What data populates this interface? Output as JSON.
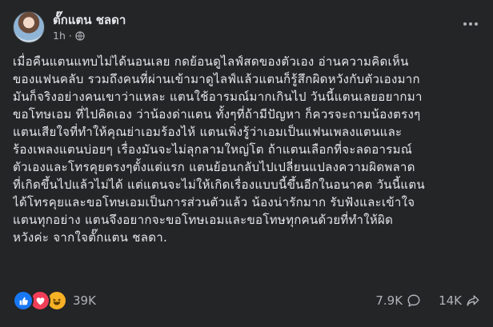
{
  "post": {
    "author": "ตั๊กแตน ชลดา",
    "time": "1h",
    "separator": "·",
    "privacy_icon": "globe-icon",
    "more_icon": "more-options-icon",
    "body_lines": [
      "เมื่อคืนแตนแทบไม่ได้นอนเลย กดย้อนดูไลฟ์สดของตัวเอง อ่านความคิดเห็น",
      "ของแฟนคลับ รวมถึงคนที่ผ่านเข้ามาดูไลฟ์แล้วแตนก็รู้สึกผิดหวังกับตัวเองมาก",
      "มันก็จริงอย่างคนเขาว่าแหละ แตนใช้อารมณ์มากเกินไป วันนี้แตนเลยอยากมา",
      "ขอโทษเอม ที่ไปคิดเอง ว่าน้องด่าแตน ทั้งๆที่ถ้ามีปัญหา ก็ควรจะถามน้องตรงๆ",
      "แตนเสียใจที่ทำให้คุณย่าเอมร้องไห้ แตนเพิ่งรู้ว่าเอมเป็นแฟนเพลงแตนและ",
      "ร้องเพลงแตนบ่อยๆ เรื่องมันจะไม่ลุกลามใหญ่โต ถ้าแตนเลือกที่จะลดอารมณ์",
      "ตัวเองและโทรคุยตรงๆตั้งแต่แรก แตนย้อนกลับไปเปลี่ยนแปลงความผิดพลาด",
      "ที่เกิดขึ้นไปแล้วไม่ได้ แต่แตนจะไม่ให้เกิดเรื่องแบบนี้ขึ้นอีกในอนาคต วันนี้แตน",
      "ได้โทรคุยและขอโทษเอมเป็นการส่วนตัวแล้ว น้องน่ารักมาก รับฟังและเข้าใจ",
      "แตนทุกอย่าง แตนจึงอยากจะขอโทษเอมและขอโทษทุกคนด้วยที่ทำให้ผิด",
      "หวังค่ะ จากใจตั๊กแตน ชลดา."
    ]
  },
  "footer": {
    "reaction_count": "39K",
    "reactions": [
      "like",
      "love",
      "haha"
    ],
    "comments_count": "7.9K",
    "comments_icon": "comment-icon",
    "shares_count": "14K",
    "shares_icon": "share-icon"
  },
  "colors": {
    "background": "#242526",
    "text_primary": "#e4e6eb",
    "text_secondary": "#b0b3b8",
    "like_blue": "#1877f2",
    "love_red": "#f33e58",
    "haha_yellow": "#f7b125"
  }
}
